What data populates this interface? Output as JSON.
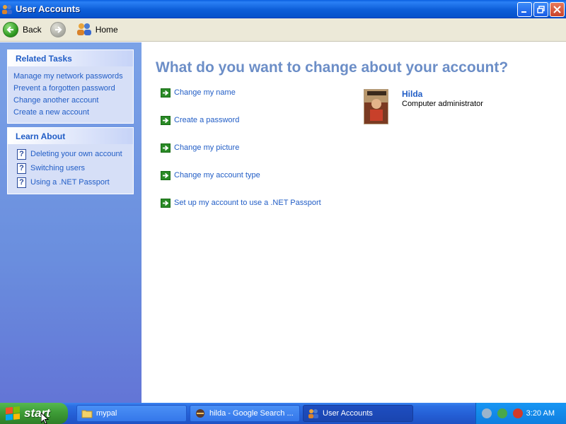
{
  "window": {
    "title": "User Accounts",
    "icon": "user-accounts-icon"
  },
  "toolbar": {
    "back_label": "Back",
    "home_label": "Home"
  },
  "sidebar": {
    "related_tasks": {
      "title": "Related Tasks",
      "items": [
        {
          "label": "Manage my network passwords"
        },
        {
          "label": "Prevent a forgotten password"
        },
        {
          "label": "Change another account"
        },
        {
          "label": "Create a new account"
        }
      ]
    },
    "learn_about": {
      "title": "Learn About",
      "items": [
        {
          "label": "Deleting your own account"
        },
        {
          "label": "Switching users"
        },
        {
          "label": "Using a .NET Passport"
        }
      ]
    }
  },
  "main": {
    "heading": "What do you want to change about your account?",
    "actions": [
      {
        "label": "Change my name"
      },
      {
        "label": "Create a password"
      },
      {
        "label": "Change my picture"
      },
      {
        "label": "Change my account type"
      },
      {
        "label": "Set up my account to use a .NET Passport"
      }
    ],
    "user": {
      "name": "Hilda",
      "role": "Computer administrator"
    }
  },
  "taskbar": {
    "start_label": "start",
    "buttons": [
      {
        "label": "mypal",
        "icon": "folder-icon"
      },
      {
        "label": "hilda - Google Search ...",
        "icon": "browser-icon"
      },
      {
        "label": "User Accounts",
        "icon": "user-accounts-icon"
      }
    ],
    "clock": "3:20 AM"
  },
  "colors": {
    "titlebar": "#0d5ed8",
    "link": "#215dc6",
    "heading": "#6c8ec7",
    "sidebar": "#6a8ede",
    "action_arrow": "#2a8a26"
  }
}
